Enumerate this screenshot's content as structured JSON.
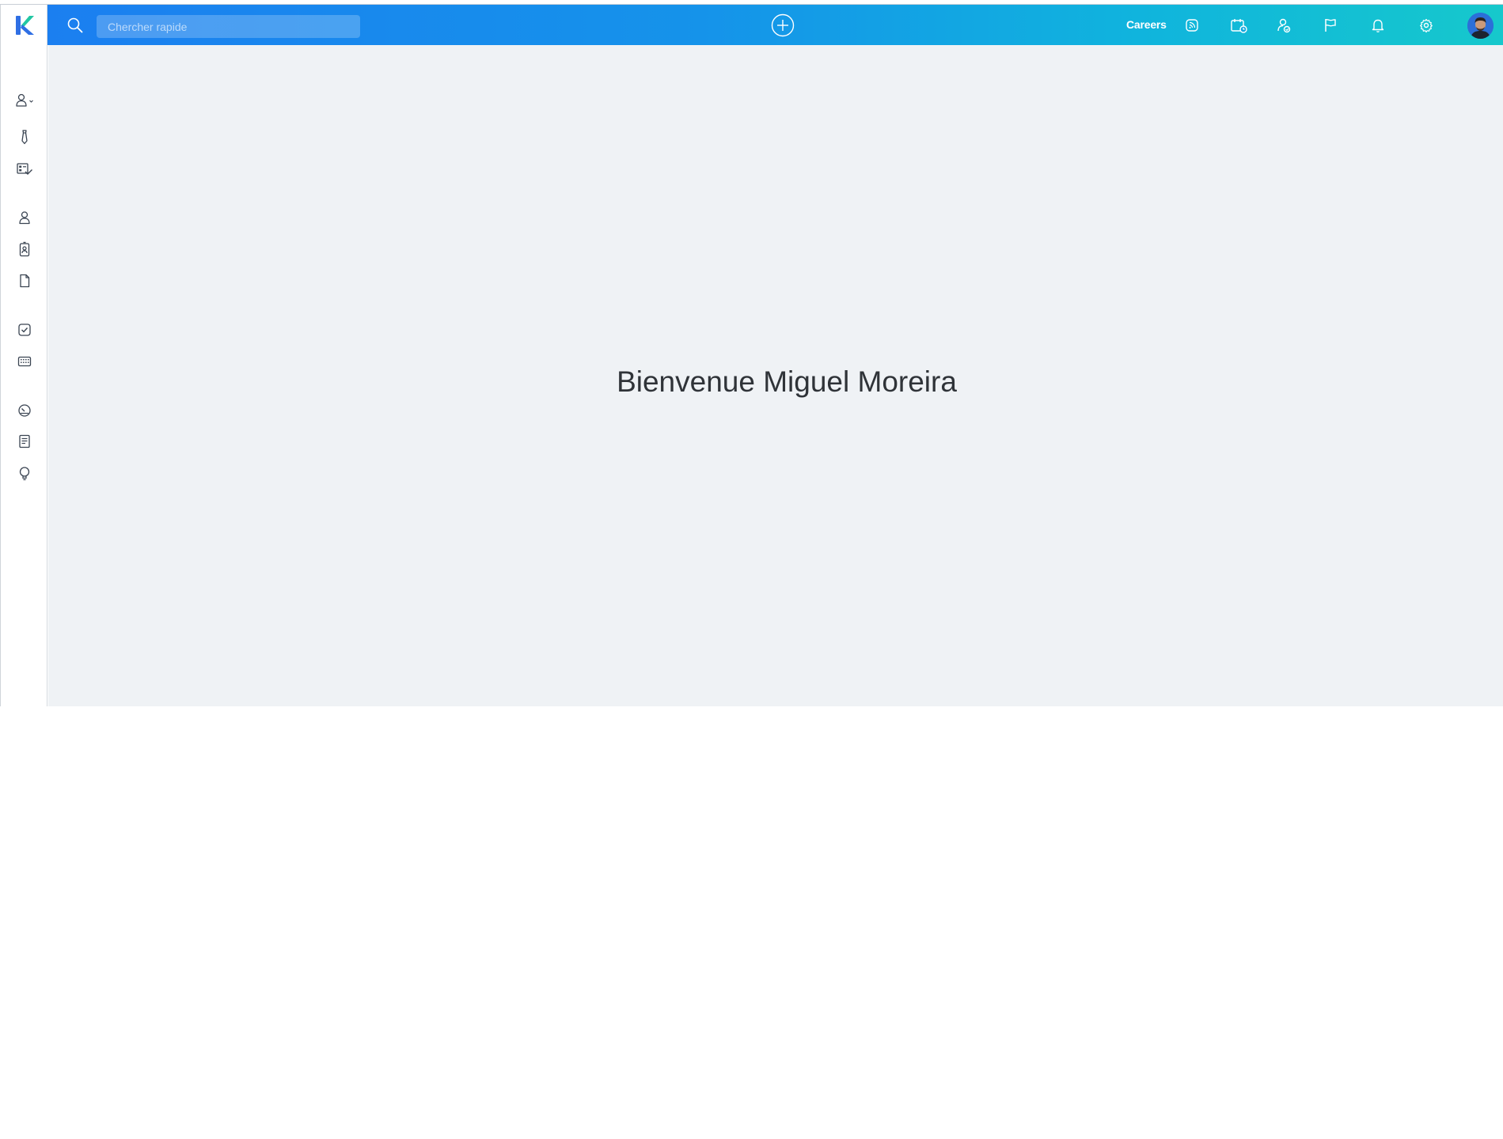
{
  "app": {
    "logo_letter": "K"
  },
  "search": {
    "placeholder": "Chercher rapide"
  },
  "header": {
    "careers_label": "Careers",
    "icons": [
      "rss-icon",
      "calendar-clock-icon",
      "user-switch-icon",
      "flag-icon",
      "bell-icon",
      "gear-icon"
    ]
  },
  "sidebar": {
    "icons": [
      "user-dropdown-icon",
      "tie-icon",
      "checklist-icon",
      "person-icon",
      "badge-icon",
      "document-icon",
      "task-check-icon",
      "calendar-grid-icon",
      "dashboard-gauge-icon",
      "report-icon",
      "lightbulb-icon"
    ]
  },
  "main": {
    "welcome_text": "Bienvenue Miguel Moreira"
  },
  "colors": {
    "topbar_start": "#1b7ff0",
    "topbar_end": "#16c8cc",
    "background": "#eff2f5",
    "logo_blue": "#2f6fe4",
    "logo_green": "#22c7a3"
  }
}
